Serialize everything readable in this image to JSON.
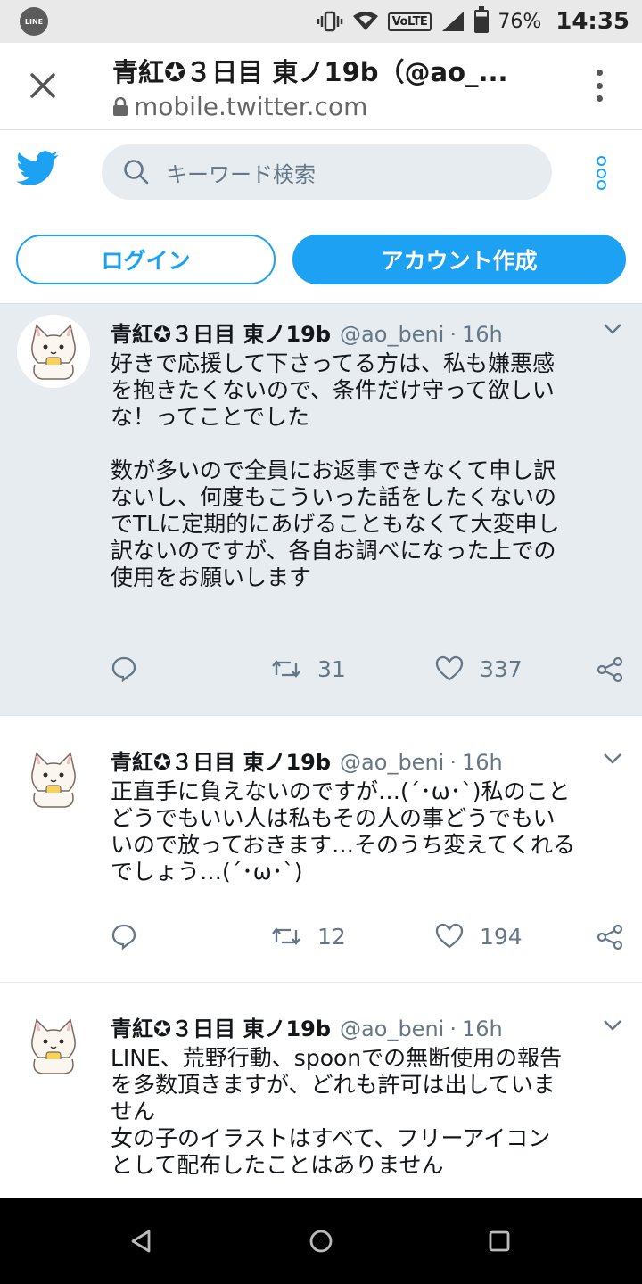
{
  "status_bar": {
    "app_icon_label": "LINE",
    "network_label": "VoLTE",
    "battery": "76%",
    "battery_level": 0.76,
    "time": "14:35"
  },
  "browser": {
    "page_title": "青紅✪３日目 東ノ19b（@ao_...",
    "url": "mobile.twitter.com"
  },
  "twitter_header": {
    "search_placeholder": "キーワード検索",
    "login_label": "ログイン",
    "signup_label": "アカウント作成",
    "brand_color": "#1da1f2"
  },
  "tweets": [
    {
      "name": "青紅✪３日目 東ノ19b",
      "handle": "@ao_beni",
      "separator": "·",
      "time": "16h",
      "text": "好きで応援して下さってる方は、私も嫌悪感\nを抱きたくないので、条件だけ守って欲しい\nな！ってことでした\n\n数が多いので全員にお返事できなくて申し訳\nないし、何度もこういった話をしたくないの\nでTLに定期的にあげることもなくて大変申し\n訳ないのですが、各自お調べになった上での\n使用をお願いします",
      "retweets": "31",
      "likes": "337"
    },
    {
      "name": "青紅✪３日目 東ノ19b",
      "handle": "@ao_beni",
      "separator": "·",
      "time": "16h",
      "text": "正直手に負えないのですが…(´･ω･`)私のこと\nどうでもいい人は私もその人の事どうでもい\nいので放っておきます…そのうち変えてくれる\nでしょう…(´･ω･`)",
      "retweets": "12",
      "likes": "194"
    },
    {
      "name": "青紅✪３日目 東ノ19b",
      "handle": "@ao_beni",
      "separator": "·",
      "time": "16h",
      "text": "LINE、荒野行動、spoonでの無断使用の報告\nを多数頂きますが、どれも許可は出していま\nせん\n女の子のイラストはすべて、フリーアイコン\nとして配布したことはありません",
      "retweets": "",
      "likes": ""
    }
  ]
}
